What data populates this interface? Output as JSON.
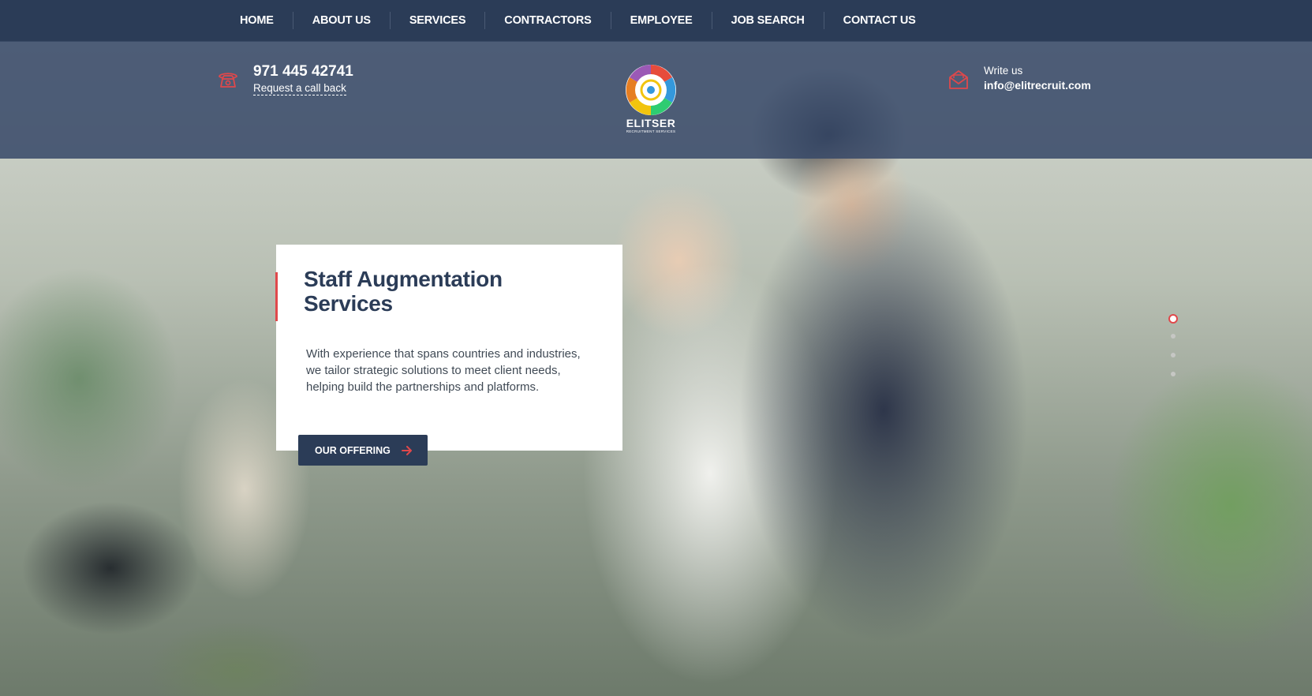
{
  "nav": {
    "items": [
      {
        "label": "HOME"
      },
      {
        "label": "ABOUT US"
      },
      {
        "label": "SERVICES"
      },
      {
        "label": "CONTRACTORS"
      },
      {
        "label": "EMPLOYEE"
      },
      {
        "label": "JOB SEARCH"
      },
      {
        "label": "CONTACT US"
      }
    ]
  },
  "header": {
    "phone_number": "971 445 42741",
    "callback_label": "Request a call back",
    "logo_name": "ELITSER",
    "logo_tagline": "RECRUITMENT SERVICES",
    "write_label": "Write us",
    "email": "info@elitrecruit.com",
    "phone_icon": "phone-icon",
    "mail_icon": "mail-icon"
  },
  "hero": {
    "title": "Staff Augmentation Services",
    "body": "With experience that spans countries and industries, we tailor strategic solutions to meet client needs, helping build the partnerships and platforms.",
    "cta_label": "OUR OFFERING",
    "slide_count": 4,
    "active_slide": 1
  },
  "colors": {
    "nav_bg": "#2b3c57",
    "accent": "#e0484b",
    "card_bg": "#ffffff",
    "title_text": "#2b3c57"
  }
}
